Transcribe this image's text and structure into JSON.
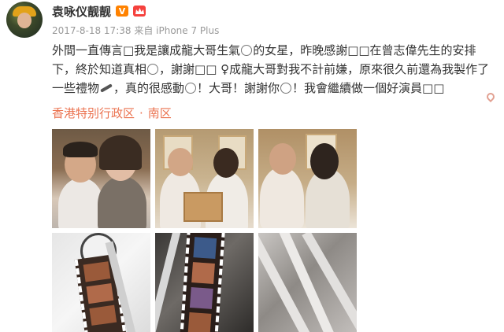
{
  "user": {
    "name": "袁咏仪靓靓",
    "vip_badge": "V",
    "avatar_icon": "avatar-image",
    "crown_icon": "crown-icon"
  },
  "post": {
    "timestamp": "2017-8-18 17:38",
    "source": "来自 iPhone 7 Plus",
    "text": {
      "l1": "外間一直傳言□我是讓成龍大哥生氣",
      "l2": "的女星，昨晚感謝□□在曾志偉先生的安排",
      "l3": "下，終於知道真相",
      "l4": "，謝謝□□ ♀成龍大哥對我不計前嫌，原來很久前還為我製作",
      "l5": "了一些禮物",
      "l6": "，真的很感動",
      "l7": "！大哥！謝謝你",
      "l8": "！我會繼續做一個好演員□□"
    },
    "location": {
      "city": "香港特别行政区",
      "separator": "·",
      "district": "南区"
    }
  },
  "photos": [
    {
      "id": "photo-1"
    },
    {
      "id": "photo-2"
    },
    {
      "id": "photo-3"
    },
    {
      "id": "photo-4"
    },
    {
      "id": "photo-5"
    },
    {
      "id": "photo-6"
    }
  ],
  "colors": {
    "link": "#eb7350",
    "vip": "#ff8200",
    "name": "#333333",
    "meta": "#999999"
  }
}
